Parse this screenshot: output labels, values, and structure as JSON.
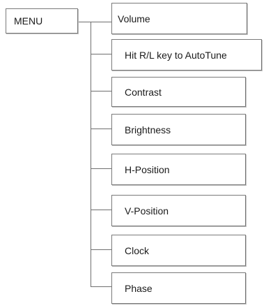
{
  "menu": {
    "label": "MENU"
  },
  "items": [
    {
      "label": "Volume"
    },
    {
      "label": "Hit R/L key to AutoTune"
    },
    {
      "label": "Contrast"
    },
    {
      "label": "Brightness"
    },
    {
      "label": "H-Position"
    },
    {
      "label": "V-Position"
    },
    {
      "label": "Clock"
    },
    {
      "label": "Phase"
    }
  ],
  "colors": {
    "line": "#6f6f6f",
    "border": "#7a7a7a",
    "background": "#ffffff"
  }
}
